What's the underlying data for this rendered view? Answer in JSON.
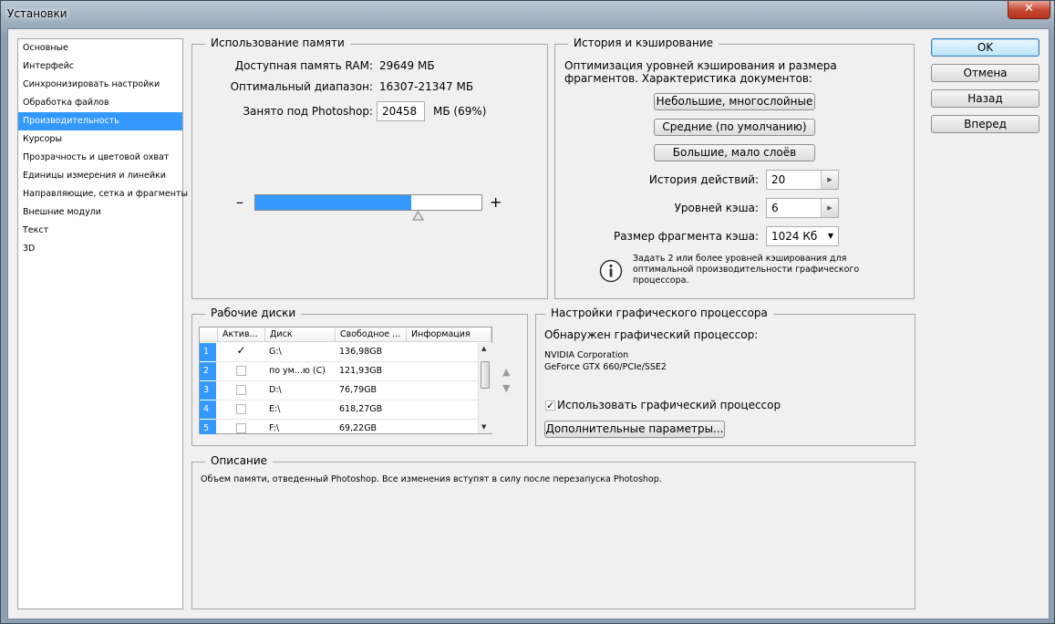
{
  "window": {
    "title": "Установки",
    "close_glyph": "✕"
  },
  "sidebar": {
    "items": [
      {
        "label": "Основные"
      },
      {
        "label": "Интерфейс"
      },
      {
        "label": "Синхронизировать настройки"
      },
      {
        "label": "Обработка файлов"
      },
      {
        "label": "Производительность",
        "selected": true
      },
      {
        "label": "Курсоры"
      },
      {
        "label": "Прозрачность и цветовой охват"
      },
      {
        "label": "Единицы измерения и линейки"
      },
      {
        "label": "Направляющие, сетка и фрагменты"
      },
      {
        "label": "Внешние модули"
      },
      {
        "label": "Текст"
      },
      {
        "label": "3D"
      }
    ]
  },
  "memory": {
    "title": "Использование памяти",
    "ram_label": "Доступная память RAM:",
    "ram_value": "29649 МБ",
    "range_label": "Оптимальный диапазон:",
    "range_value": "16307-21347 МБ",
    "ps_label": "Занято под Photoshop:",
    "ps_value": "20458",
    "ps_unit": "МБ (69%)",
    "minus": "–",
    "plus": "+",
    "slider_fraction": 0.69
  },
  "history": {
    "title": "История и кэширование",
    "desc": "Оптимизация уровней кэширования и размера фрагментов. Характеристика документов:",
    "btn_small": "Небольшие, многослойные",
    "btn_medium": "Средние (по умолчанию)",
    "btn_large": "Большие, мало слоёв",
    "states_label": "История действий:",
    "states_value": "20",
    "cache_label": "Уровней кэша:",
    "cache_value": "6",
    "tile_label": "Размер фрагмента кэша:",
    "tile_value": "1024 Кб",
    "info_text": "Задать 2 или более уровней кэширования для оптимальной производительности графического процессора.",
    "info_icon": "i"
  },
  "scratch": {
    "title": "Рабочие диски",
    "headers": [
      "Актив...",
      "Диск",
      "Свободное ...",
      "Информация"
    ],
    "rows": [
      {
        "num": "1",
        "active": true,
        "disk": "G:\\",
        "free": "136,98GB",
        "info": ""
      },
      {
        "num": "2",
        "active": false,
        "disk": "по ум...ю (C)",
        "free": "121,93GB",
        "info": ""
      },
      {
        "num": "3",
        "active": false,
        "disk": "D:\\",
        "free": "76,79GB",
        "info": ""
      },
      {
        "num": "4",
        "active": false,
        "disk": "E:\\",
        "free": "618,27GB",
        "info": ""
      },
      {
        "num": "5",
        "active": false,
        "disk": "F:\\",
        "free": "69,22GB",
        "info": ""
      }
    ],
    "check_glyph": "✓"
  },
  "gpu": {
    "title": "Настройки графического процессора",
    "detected": "Обнаружен графический процессор:",
    "vendor": "NVIDIA Corporation",
    "model": "GeForce GTX 660/PCIe/SSE2",
    "use_label": "Использовать графический процессор",
    "use_checked": true,
    "advanced": "Дополнительные параметры..."
  },
  "description": {
    "title": "Описание",
    "text": "Объем памяти, отведенный Photoshop. Все изменения вступят в силу после перезапуска Photoshop."
  },
  "buttons": {
    "ok": "OK",
    "cancel": "Отмена",
    "back": "Назад",
    "next": "Вперед"
  },
  "colors": {
    "accent": "#3399ff",
    "slider_fill": "#3399ff"
  }
}
